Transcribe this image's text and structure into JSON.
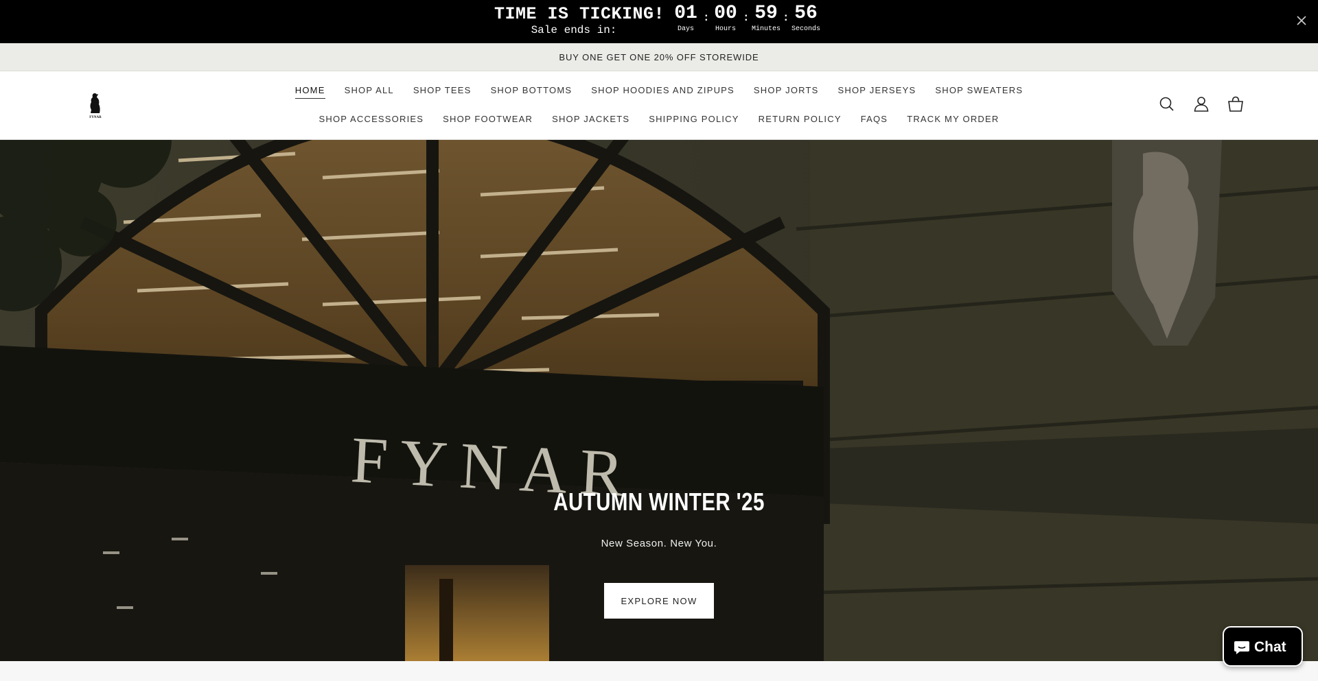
{
  "countdown": {
    "title": "TIME IS TICKING!",
    "subtitle": "Sale ends in:",
    "days": "01",
    "days_label": "Days",
    "hours": "00",
    "hours_label": "Hours",
    "minutes": "59",
    "minutes_label": "Minutes",
    "seconds": "56",
    "seconds_label": "Seconds",
    "separator": ":",
    "close_icon": "close-icon"
  },
  "announcement": {
    "text": "BUY ONE GET ONE 20% OFF STOREWIDE"
  },
  "header": {
    "logo_icon": "fynar-logo",
    "nav_row1": [
      "HOME",
      "SHOP ALL",
      "SHOP TEES",
      "SHOP BOTTOMS",
      "SHOP HOODIES AND ZIPUPS",
      "SHOP JORTS",
      "SHOP JERSEYS",
      "SHOP SWEATERS"
    ],
    "nav_row2": [
      "SHOP ACCESSORIES",
      "SHOP FOOTWEAR",
      "SHOP JACKETS",
      "SHIPPING POLICY",
      "RETURN POLICY",
      "FAQS",
      "TRACK MY ORDER"
    ],
    "active": "HOME",
    "icons": [
      "search-icon",
      "account-icon",
      "cart-icon"
    ]
  },
  "hero": {
    "sign_text": "FYNAR",
    "title": "AUTUMN WINTER '25",
    "subtitle": "New Season. New You.",
    "button": "EXPLORE NOW"
  },
  "chat": {
    "label": "Chat",
    "icon": "chat-bubble-icon"
  },
  "colors": {
    "bar": "#000000",
    "announce_bg": "#ebebe7",
    "header_bg": "#ffffff",
    "button_bg": "#ffffff"
  }
}
